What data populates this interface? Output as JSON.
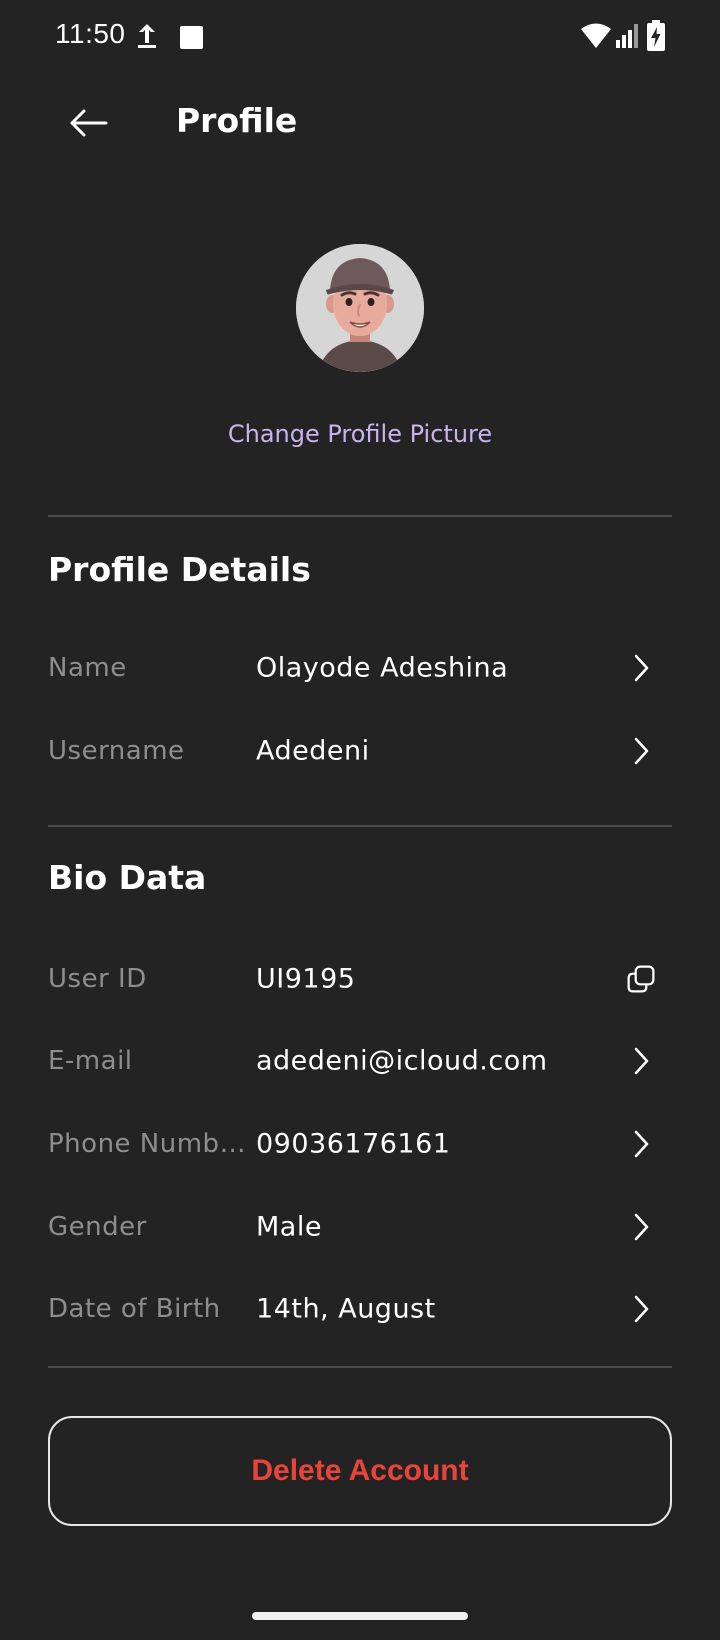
{
  "status_bar": {
    "time": "11:50",
    "icons": [
      "upload-icon",
      "stop-square-icon",
      "wifi-icon",
      "signal-icon",
      "battery-charging-icon"
    ]
  },
  "header": {
    "back_icon": "arrow-left-icon",
    "title": "Profile"
  },
  "avatar": {
    "icon": "avatar-3d-man-cap",
    "change_label": "Change Profile Picture"
  },
  "profile_details": {
    "title": "Profile Details",
    "rows": [
      {
        "label": "Name",
        "value": "Olayode Adeshina",
        "action_icon": "chevron-right-icon"
      },
      {
        "label": "Username",
        "value": "Adedeni",
        "action_icon": "chevron-right-icon"
      }
    ]
  },
  "bio_data": {
    "title": "Bio Data",
    "rows": [
      {
        "label": "User ID",
        "value": "UI9195",
        "action_icon": "copy-icon"
      },
      {
        "label": "E-mail",
        "value": "adedeni@icloud.com",
        "action_icon": "chevron-right-icon"
      },
      {
        "label": "Phone Numb…",
        "value": "09036176161",
        "action_icon": "chevron-right-icon"
      },
      {
        "label": "Gender",
        "value": "Male",
        "action_icon": "chevron-right-icon"
      },
      {
        "label": "Date of Birth",
        "value": "14th, August",
        "action_icon": "chevron-right-icon"
      }
    ]
  },
  "delete_button": {
    "label": "Delete Account"
  },
  "colors": {
    "background": "#232323",
    "accent_link": "#c9b3ee",
    "danger": "#e8443a",
    "label_gray": "#8e8e8e",
    "divider": "#4a4a4a"
  }
}
